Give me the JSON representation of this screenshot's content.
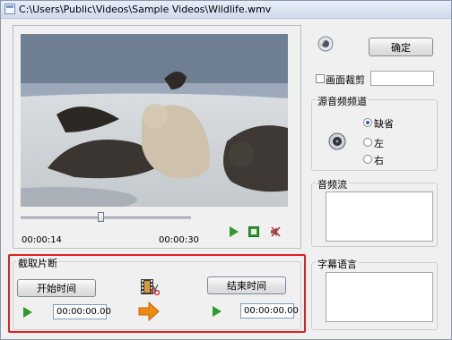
{
  "window": {
    "title": "C:\\Users\\Public\\Videos\\Sample Videos\\Wildlife.wmv"
  },
  "player": {
    "current_time": "00:00:14",
    "total_time": "00:00:30",
    "progress": 0.47
  },
  "buttons": {
    "ok_label": "确定"
  },
  "crop": {
    "label": "画面裁剪",
    "checked": false,
    "value": ""
  },
  "audio_channel": {
    "title": "源音频频道",
    "options": [
      "缺省",
      "左",
      "右"
    ],
    "selected": "缺省"
  },
  "audio_stream": {
    "title": "音频流"
  },
  "subtitle_lang": {
    "title": "字幕语言"
  },
  "clip": {
    "title": "截取片断",
    "start_label": "开始时间",
    "end_label": "结束时间",
    "start_time": "00:00:00.00",
    "end_time": "00:00:00.00"
  },
  "colors": {
    "highlight_border": "#e02020",
    "play_green": "#2f9a2f",
    "arrow_orange": "#f08a10"
  }
}
